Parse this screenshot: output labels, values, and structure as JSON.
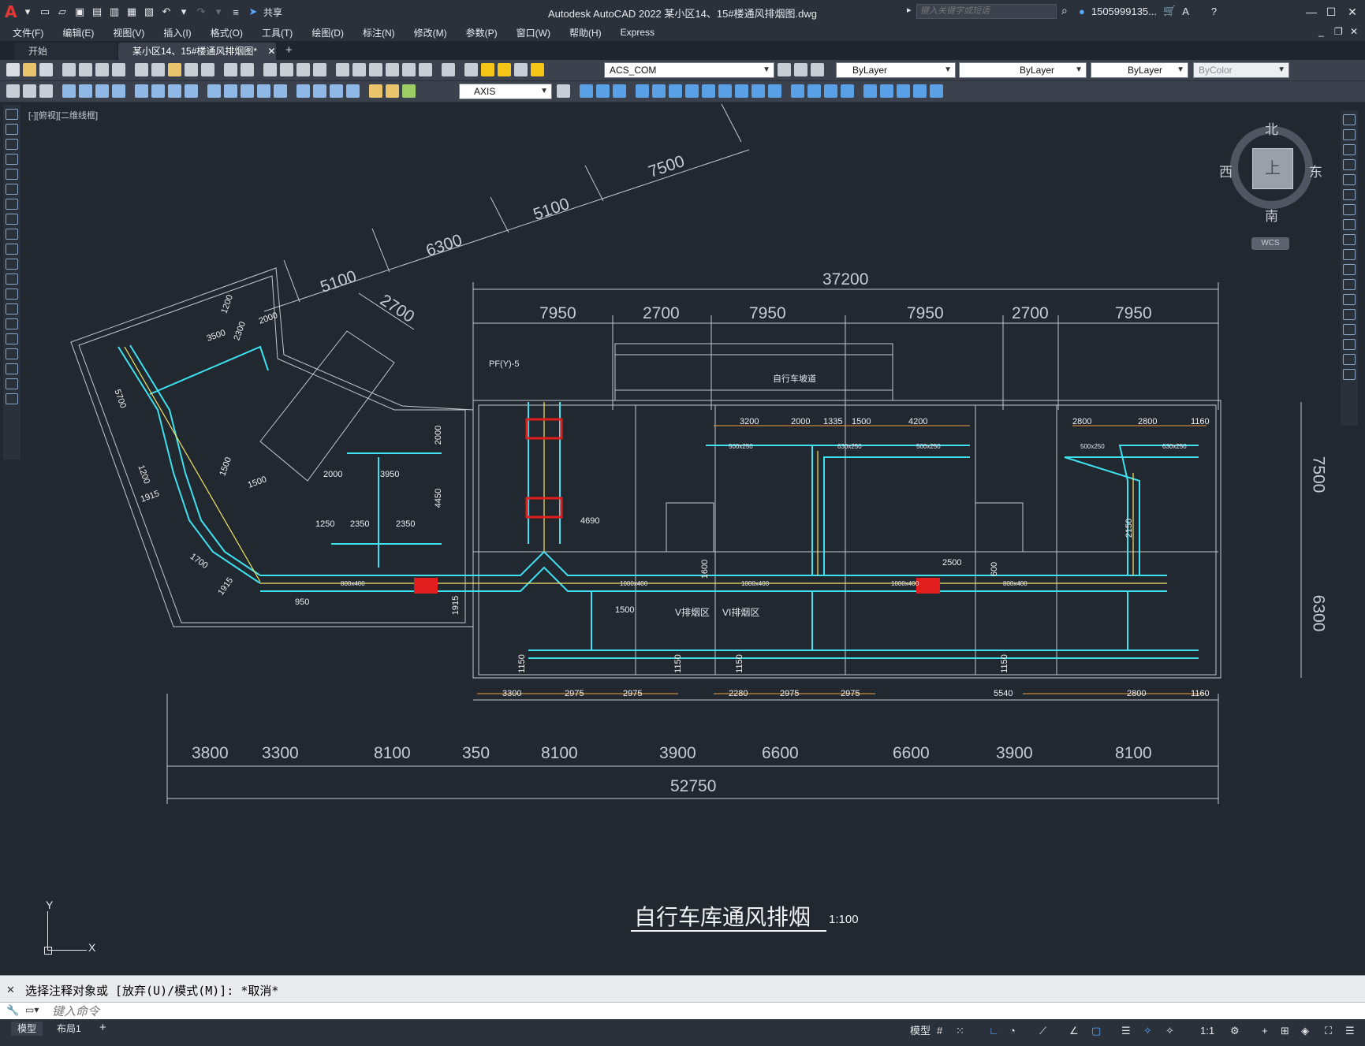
{
  "app": {
    "title": "Autodesk AutoCAD 2022    某小区14、15#楼通风排烟图.dwg",
    "logo": "A",
    "share_label": "共享",
    "search_placeholder": "键入关键字或短语",
    "user_label": "1505999135...",
    "accent_color": "#e53935"
  },
  "menu": {
    "items": [
      "文件(F)",
      "编辑(E)",
      "视图(V)",
      "插入(I)",
      "格式(O)",
      "工具(T)",
      "绘图(D)",
      "标注(N)",
      "修改(M)",
      "参数(P)",
      "窗口(W)",
      "帮助(H)",
      "Express"
    ]
  },
  "tabs": {
    "start": "开始",
    "drawing": "某小区14、15#楼通风排烟图*"
  },
  "toolbar": {
    "layer_name": "ACS_COM",
    "color": "ByLayer",
    "linetype": "ByLayer",
    "lineweight": "ByLayer",
    "plotstyle": "ByColor",
    "dimstyle": "AXIS"
  },
  "viewport": {
    "label": "[-][俯视][二维线框]"
  },
  "viewcube": {
    "north": "北",
    "south": "南",
    "east": "东",
    "west": "西",
    "face": "上",
    "wcs": "WCS"
  },
  "drawing": {
    "title": "自行车库通风排烟",
    "scale": "1:100",
    "room_label": "自行车坡道",
    "zone_labels": [
      "V排烟区",
      "VI排烟区"
    ],
    "equipment_label": "PF(Y)-5",
    "ucs_x": "X",
    "ucs_y": "Y",
    "dims_top_outer": "37200",
    "dims_top": [
      "7950",
      "2700",
      "7950",
      "7950",
      "2700",
      "7950"
    ],
    "dims_angled": [
      "5100",
      "6300",
      "5100",
      "7500",
      "2700"
    ],
    "dims_bottom": [
      "3800",
      "3300",
      "8100",
      "350",
      "8100",
      "3900",
      "6600",
      "6600",
      "3900",
      "8100"
    ],
    "dims_bottom_total": "52750",
    "dims_right": [
      "7500",
      "6300"
    ],
    "dims_row_bottom": [
      "3300",
      "2975",
      "2975",
      "2280",
      "2975",
      "2975",
      "5540",
      "2800",
      "1160"
    ],
    "dims_row_top": [
      "3200",
      "2000",
      "1335",
      "1500",
      "4200",
      "2800",
      "2800",
      "1160"
    ],
    "duct_sizes": [
      "800x400",
      "1000x400",
      "1000x400",
      "1000x400",
      "800x400",
      "500x250",
      "630x250",
      "500x250",
      "500x250",
      "630x250"
    ],
    "misc_dims": [
      "4690",
      "2500",
      "1600",
      "600",
      "2150",
      "1500",
      "1915",
      "950",
      "2000",
      "3950",
      "4450",
      "1250",
      "2350",
      "2350",
      "2000",
      "1200",
      "2000",
      "3500",
      "2300",
      "5700",
      "1200",
      "1915",
      "1500",
      "1500",
      "1700",
      "1915",
      "1150",
      "1150",
      "1150",
      "1150"
    ]
  },
  "command": {
    "history": "选择注释对象或 [放弃(U)/模式(M)]: *取消*",
    "placeholder": "键入命令"
  },
  "status": {
    "model_tab": "模型",
    "layout1_tab": "布局1",
    "model_btn": "模型",
    "scale": "1:1"
  }
}
